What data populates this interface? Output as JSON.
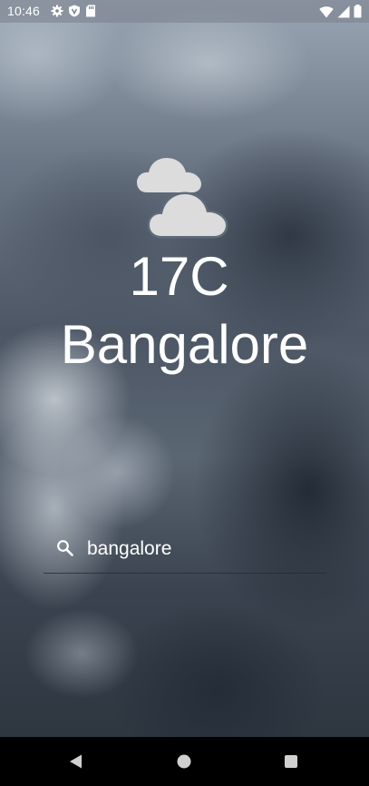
{
  "status_bar": {
    "time": "10:46",
    "left_icons": [
      "gear-icon",
      "shield-icon",
      "sd-card-icon"
    ],
    "right_icons": [
      "wifi-icon",
      "cell-signal-icon",
      "battery-icon"
    ]
  },
  "weather": {
    "icon": "cloudy-icon",
    "temperature": "17C",
    "city": "Bangalore"
  },
  "search": {
    "icon": "search-icon",
    "value": "bangalore"
  },
  "nav_bar": {
    "buttons": [
      "back-button",
      "home-button",
      "recents-button"
    ]
  },
  "colors": {
    "text": "#ffffff",
    "icon_fill": "#dcdcdc",
    "nav_background": "#000000"
  }
}
